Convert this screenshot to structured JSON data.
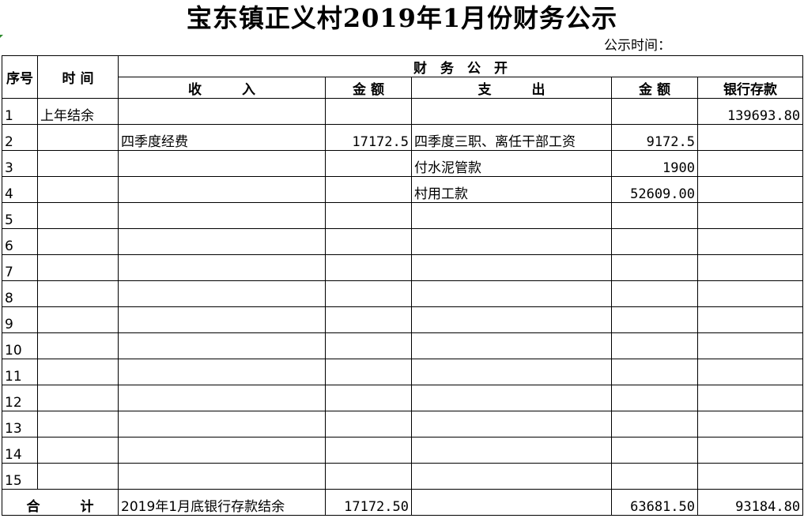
{
  "title": "宝东镇正义村2019年1月份财务公示",
  "publish_time_label": "公示时间：",
  "header": {
    "seq": "序号",
    "time": "时 间",
    "finance_public": "财　务　公　开",
    "income": "收　　　入",
    "amount": "金 额",
    "expense": "支　　　出",
    "amount2": "金 额",
    "bank_deposit": "银行存款"
  },
  "rows": [
    {
      "seq": "1",
      "time": "上年结余",
      "income": "",
      "income_amount": "",
      "expense": "",
      "expense_amount": "",
      "bank": "139693.80"
    },
    {
      "seq": "2",
      "time": "",
      "income": "四季度经费",
      "income_amount": "17172.5",
      "expense": "四季度三职、离任干部工资",
      "expense_amount": "9172.5",
      "bank": ""
    },
    {
      "seq": "3",
      "time": "",
      "income": "",
      "income_amount": "",
      "expense": "付水泥管款",
      "expense_amount": "1900",
      "bank": ""
    },
    {
      "seq": "4",
      "time": "",
      "income": "",
      "income_amount": "",
      "expense": "村用工款",
      "expense_amount": "52609.00",
      "bank": ""
    },
    {
      "seq": "5",
      "time": "",
      "income": "",
      "income_amount": "",
      "expense": "",
      "expense_amount": "",
      "bank": ""
    },
    {
      "seq": "6",
      "time": "",
      "income": "",
      "income_amount": "",
      "expense": "",
      "expense_amount": "",
      "bank": ""
    },
    {
      "seq": "7",
      "time": "",
      "income": "",
      "income_amount": "",
      "expense": "",
      "expense_amount": "",
      "bank": ""
    },
    {
      "seq": "8",
      "time": "",
      "income": "",
      "income_amount": "",
      "expense": "",
      "expense_amount": "",
      "bank": ""
    },
    {
      "seq": "9",
      "time": "",
      "income": "",
      "income_amount": "",
      "expense": "",
      "expense_amount": "",
      "bank": ""
    },
    {
      "seq": "10",
      "time": "",
      "income": "",
      "income_amount": "",
      "expense": "",
      "expense_amount": "",
      "bank": ""
    },
    {
      "seq": "11",
      "time": "",
      "income": "",
      "income_amount": "",
      "expense": "",
      "expense_amount": "",
      "bank": ""
    },
    {
      "seq": "12",
      "time": "",
      "income": "",
      "income_amount": "",
      "expense": "",
      "expense_amount": "",
      "bank": ""
    },
    {
      "seq": "13",
      "time": "",
      "income": "",
      "income_amount": "",
      "expense": "",
      "expense_amount": "",
      "bank": ""
    },
    {
      "seq": "14",
      "time": "",
      "income": "",
      "income_amount": "",
      "expense": "",
      "expense_amount": "",
      "bank": ""
    },
    {
      "seq": "15",
      "time": "",
      "income": "",
      "income_amount": "",
      "expense": "",
      "expense_amount": "",
      "bank": ""
    }
  ],
  "total": {
    "label": "合　　　计",
    "income_note": "2019年1月底银行存款结余",
    "income_amount": "17172.50",
    "expense": "",
    "expense_amount": "63681.50",
    "bank": "93184.80"
  }
}
